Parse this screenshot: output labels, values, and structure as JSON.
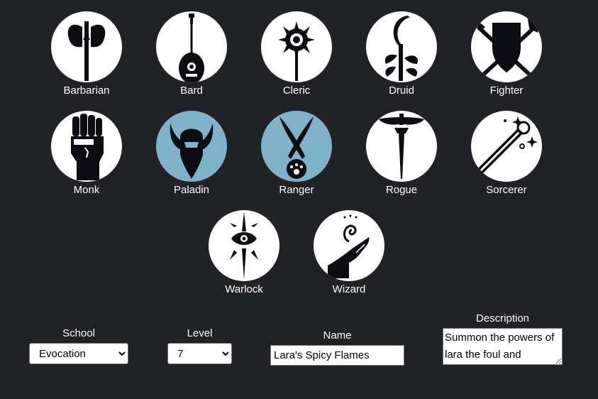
{
  "classes": [
    {
      "name": "Barbarian",
      "icon": "axe-icon",
      "selected": false
    },
    {
      "name": "Bard",
      "icon": "lute-icon",
      "selected": false
    },
    {
      "name": "Cleric",
      "icon": "mace-icon",
      "selected": false
    },
    {
      "name": "Druid",
      "icon": "sickle-leaves-icon",
      "selected": false
    },
    {
      "name": "Fighter",
      "icon": "shield-crossed-weapons-icon",
      "selected": false
    },
    {
      "name": "Monk",
      "icon": "fist-icon",
      "selected": false
    },
    {
      "name": "Paladin",
      "icon": "winged-helm-icon",
      "selected": true
    },
    {
      "name": "Ranger",
      "icon": "crossed-blades-paw-icon",
      "selected": true
    },
    {
      "name": "Rogue",
      "icon": "mask-dagger-icon",
      "selected": false
    },
    {
      "name": "Sorcerer",
      "icon": "sparkle-staff-icon",
      "selected": false
    },
    {
      "name": "Warlock",
      "icon": "eye-star-icon",
      "selected": false
    },
    {
      "name": "Wizard",
      "icon": "spell-hand-icon",
      "selected": false
    }
  ],
  "form": {
    "school_label": "School",
    "school_value": "Evocation",
    "level_label": "Level",
    "level_value": "7",
    "name_label": "Name",
    "name_value": "Lara's Spicy Flames",
    "description_label": "Description",
    "description_value": "Summon the powers of lara the foul and"
  },
  "colors": {
    "background": "#202225",
    "icon_fill": "#0b0d12",
    "selected_circle": "#7fb2c9"
  }
}
